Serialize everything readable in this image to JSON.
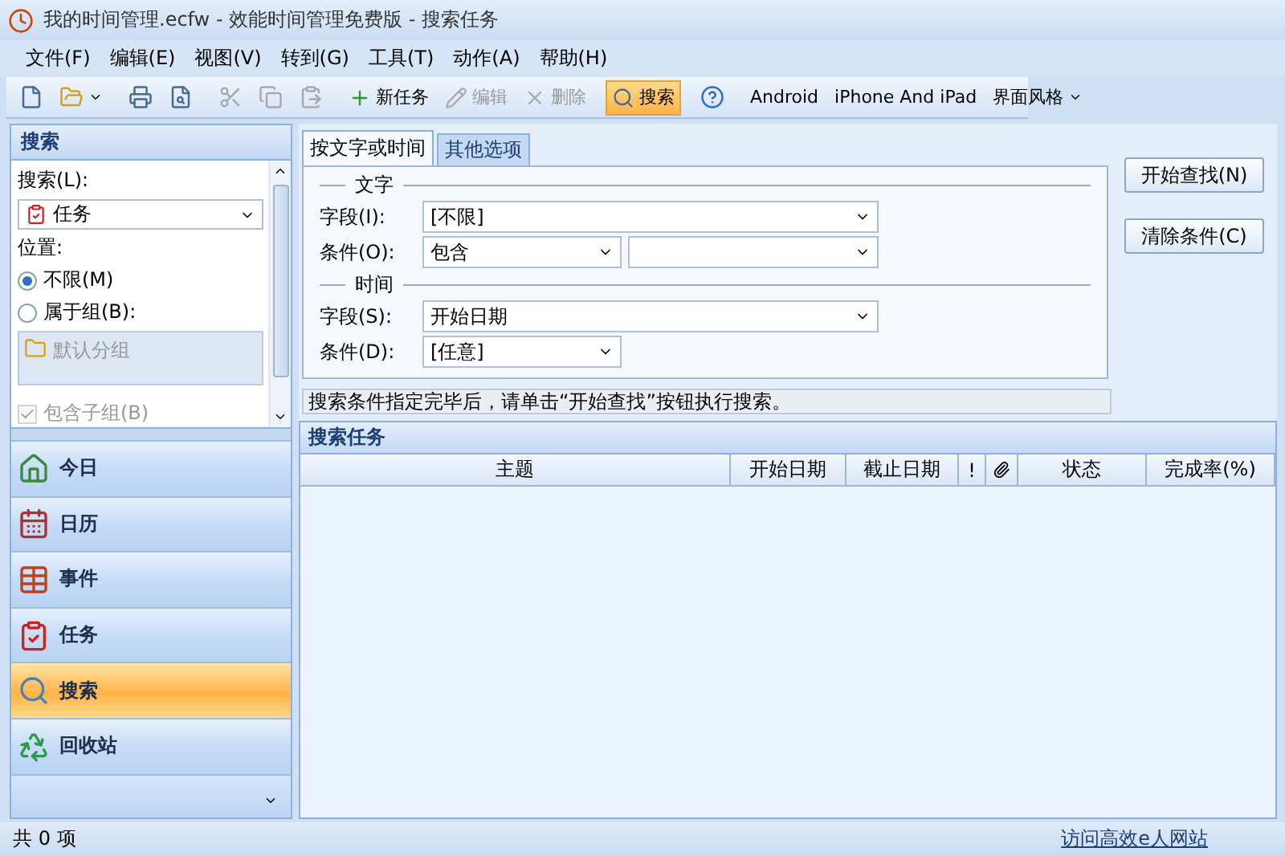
{
  "window": {
    "title": "我的时间管理.ecfw - 效能时间管理免费版 - 搜索任务"
  },
  "menu": [
    "文件(F)",
    "编辑(E)",
    "视图(V)",
    "转到(G)",
    "工具(T)",
    "动作(A)",
    "帮助(H)"
  ],
  "toolbar": [
    {
      "kind": "icon",
      "disabled": false
    },
    {
      "kind": "split",
      "disabled": false
    },
    {
      "kind": "icon",
      "disabled": false
    },
    {
      "kind": "icon",
      "disabled": false
    },
    {
      "kind": "icon",
      "disabled": true
    },
    {
      "kind": "icon",
      "disabled": true
    },
    {
      "kind": "icon",
      "disabled": true
    },
    {
      "kind": "button",
      "label": "新任务",
      "disabled": false,
      "selected": false
    },
    {
      "kind": "button",
      "label": "编辑",
      "disabled": true,
      "selected": false
    },
    {
      "kind": "button",
      "label": "删除",
      "disabled": true,
      "selected": false
    },
    {
      "kind": "button",
      "label": "搜索",
      "disabled": false,
      "selected": true
    },
    {
      "kind": "icon",
      "disabled": false
    },
    {
      "kind": "text",
      "label": "Android"
    },
    {
      "kind": "text",
      "label": "iPhone And iPad"
    },
    {
      "kind": "menu",
      "label": "界面风格"
    }
  ],
  "sidebar": {
    "title": "搜索",
    "search_label": "搜索(L):",
    "search_value": "任务",
    "location_label": "位置:",
    "radios": [
      {
        "label": "不限(M)",
        "selected": true
      },
      {
        "label": "属于组(B):",
        "selected": false
      }
    ],
    "groups": [
      {
        "label": "默认分组",
        "disabled": true
      }
    ],
    "include_subgroups": {
      "label": "包含子组(B)",
      "checked": true,
      "disabled": true
    },
    "nav": [
      {
        "label": "今日",
        "selected": false
      },
      {
        "label": "日历",
        "selected": false
      },
      {
        "label": "事件",
        "selected": false
      },
      {
        "label": "任务",
        "selected": false
      },
      {
        "label": "搜索",
        "selected": true
      },
      {
        "label": "回收站",
        "selected": false
      }
    ]
  },
  "tabs": [
    {
      "label": "按文字或时间",
      "selected": true
    },
    {
      "label": "其他选项",
      "selected": false
    }
  ],
  "text_section": {
    "title": "文字",
    "field_label": "字段(I):",
    "field_value": "[不限]",
    "condition_label": "条件(O):",
    "condition_value": "包含"
  },
  "time_section": {
    "title": "时间",
    "field_label": "字段(S):",
    "field_value": "开始日期",
    "condition_label": "条件(D):",
    "condition_value": "[任意]"
  },
  "buttons": [
    "开始查找(N)",
    "清除条件(C)"
  ],
  "hint": "搜索条件指定完毕后，请单击“开始查找”按钮执行搜索。",
  "results": {
    "title": "搜索任务",
    "columns": [
      {
        "kind": "text",
        "label": "主题"
      },
      {
        "kind": "text",
        "label": "开始日期"
      },
      {
        "kind": "text",
        "label": "截止日期"
      },
      {
        "kind": "text",
        "label": "!"
      },
      {
        "kind": "icon"
      },
      {
        "kind": "text",
        "label": "状态"
      },
      {
        "kind": "text",
        "label": "完成率(%)"
      }
    ]
  },
  "status_bar": {
    "count": "共 0 项",
    "link": "访问高效e人网站"
  }
}
